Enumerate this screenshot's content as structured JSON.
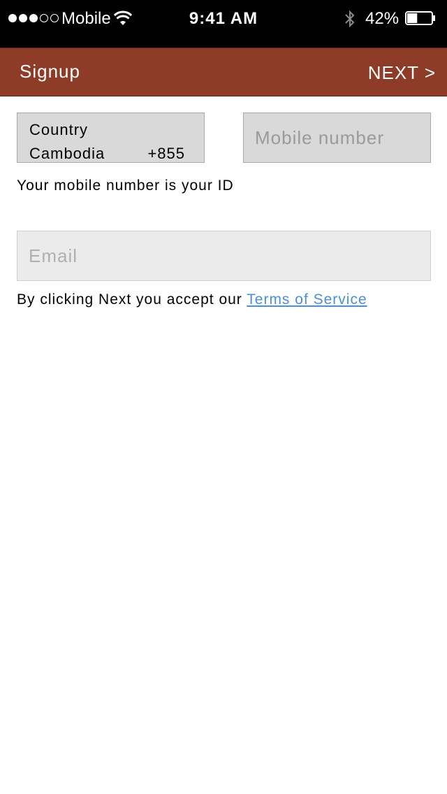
{
  "status_bar": {
    "carrier": "Mobile",
    "time": "9:41 AM",
    "battery_percent": "42%",
    "battery_level": 0.42,
    "signal_bars_filled": 3,
    "signal_bars_total": 5,
    "icons": [
      "signal-dots",
      "wifi-icon",
      "bluetooth-icon",
      "battery-icon"
    ]
  },
  "nav": {
    "title": "Signup",
    "next_label": "NEXT >",
    "background_color": "#8e3c28"
  },
  "form": {
    "country": {
      "label": "Country",
      "name": "Cambodia",
      "code": "+855"
    },
    "mobile": {
      "placeholder": "Mobile number",
      "value": ""
    },
    "id_note": "Your mobile number is your ID",
    "email": {
      "placeholder": "Email",
      "value": ""
    },
    "terms": {
      "prefix": "By clicking Next you accept our ",
      "link_label": "Terms of Service",
      "link_color": "#4a90d9"
    }
  }
}
